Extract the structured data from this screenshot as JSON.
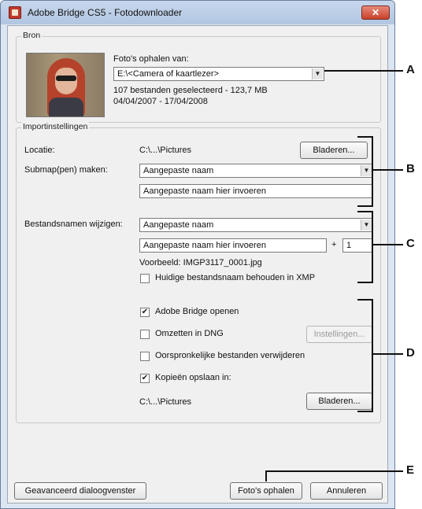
{
  "window": {
    "title": "Adobe Bridge CS5 - Fotodownloader",
    "close_glyph": "✕"
  },
  "source": {
    "group_label": "Bron",
    "get_photos_from_label": "Foto's ophalen van:",
    "device_value": "E:\\<Camera of kaartlezer>",
    "selection_info": "107 bestanden geselecteerd - 123,7 MB",
    "date_range": "04/04/2007 - 17/04/2008"
  },
  "import": {
    "group_label": "Importinstellingen",
    "location_label": "Locatie:",
    "location_value": "C:\\...\\Pictures",
    "browse_label": "Bladeren...",
    "subfolder_label": "Submap(pen) maken:",
    "subfolder_value": "Aangepaste naam",
    "subfolder_name_field": "Aangepaste naam hier invoeren",
    "rename_label": "Bestandsnamen wijzigen:",
    "rename_value": "Aangepaste naam",
    "rename_name_field": "Aangepaste naam hier invoeren",
    "plus": "+",
    "start_number": "1",
    "example": "Voorbeeld: IMGP3117_0001.jpg",
    "keep_filename_label": "Huidige bestandsnaam behouden in XMP",
    "keep_filename_checked": false,
    "open_bridge_label": "Adobe Bridge openen",
    "open_bridge_checked": true,
    "convert_dng_label": "Omzetten in DNG",
    "convert_dng_checked": false,
    "settings_label": "Instellingen...",
    "delete_originals_label": "Oorspronkelijke bestanden verwijderen",
    "delete_originals_checked": false,
    "save_copies_label": "Kopieën opslaan in:",
    "save_copies_checked": true,
    "copies_path": "C:\\...\\Pictures",
    "copies_browse_label": "Bladeren..."
  },
  "footer": {
    "advanced_label": "Geavanceerd dialoogvenster",
    "get_photos_label": "Foto's ophalen",
    "cancel_label": "Annuleren"
  },
  "callouts": {
    "a": "A",
    "b": "B",
    "c": "C",
    "d": "D",
    "e": "E"
  },
  "glyphs": {
    "dropdown": "▼",
    "check": "✔"
  }
}
